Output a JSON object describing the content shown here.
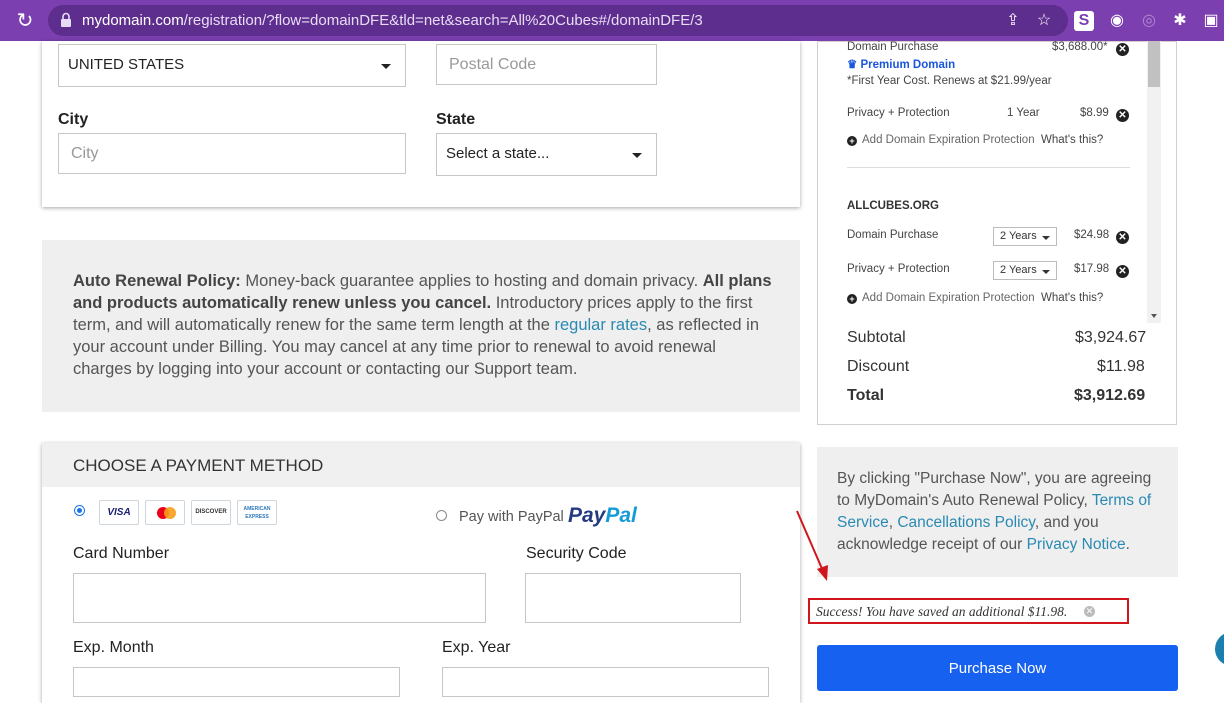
{
  "browser": {
    "url_host": "mydomain.com",
    "url_path": "/registration/?flow=domainDFE&tld=net&search=All%20Cubes#/domainDFE/3"
  },
  "address_form": {
    "country_value": "UNITED STATES",
    "postal_placeholder": "Postal Code",
    "city_label": "City",
    "city_placeholder": "City",
    "state_label": "State",
    "state_value": "Select a state..."
  },
  "policy": {
    "lead_bold": "Auto Renewal Policy:",
    "text1": " Money-back guarantee applies to hosting and domain privacy. ",
    "bold2": "All plans and products automatically renew unless you cancel.",
    "text2": " Introductory prices apply to the first term, and will automatically renew for the same term length at the ",
    "link": "regular rates",
    "text3": ", as reflected in your account under Billing. You may cancel at any time prior to renewal to avoid renewal charges by logging into your account or contacting our Support team."
  },
  "payment": {
    "title": "CHOOSE A PAYMENT METHOD",
    "cards": [
      "VISA",
      "MC",
      "DISCOVER",
      "AMERICAN EXPRESS"
    ],
    "paypal_label": "Pay with PayPal",
    "paypal_logo_a": "Pay",
    "paypal_logo_b": "Pal",
    "card_number_label": "Card Number",
    "security_code_label": "Security Code",
    "exp_month_label": "Exp. Month",
    "exp_year_label": "Exp. Year"
  },
  "summary": {
    "item1_name": "Domain Purchase",
    "item1_price": "$3,688.00*",
    "premium_label": "Premium Domain",
    "item1_note": "*First Year Cost. Renews at $21.99/year",
    "privacy1_name": "Privacy + Protection",
    "privacy1_term": "1 Year",
    "privacy1_price": "$8.99",
    "add_protection_1": "Add Domain Expiration Protection",
    "whats_this_1": "What's this?",
    "domain2_header": "ALLCUBES.ORG",
    "item2_name": "Domain Purchase",
    "item2_term": "2 Years",
    "item2_price": "$24.98",
    "privacy2_name": "Privacy + Protection",
    "privacy2_term": "2 Years",
    "privacy2_price": "$17.98",
    "add_protection_2": "Add Domain Expiration Protection",
    "whats_this_2": "What's this?",
    "subtotal_label": "Subtotal",
    "subtotal_value": "$3,924.67",
    "discount_label": "Discount",
    "discount_value": "$11.98",
    "total_label": "Total",
    "total_value": "$3,912.69"
  },
  "agreement": {
    "text1": "By clicking \"Purchase Now\", you are agreeing to MyDomain's Auto Renewal Policy, ",
    "link1": "Terms of Service",
    "sep1": ", ",
    "link2": "Cancellations Policy",
    "text2": ", and you acknowledge receipt of our ",
    "link3": "Privacy Notice",
    "text3": "."
  },
  "success_message": "Success! You have saved an additional $11.98.",
  "purchase_button": "Purchase Now",
  "colors": {
    "chrome": "#7b3fb0",
    "link": "#2a8ab2",
    "purchase_button": "#1761f0",
    "annotation_red": "#d0161b"
  }
}
